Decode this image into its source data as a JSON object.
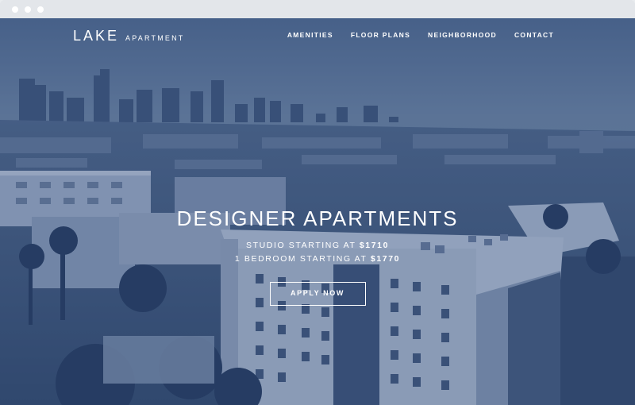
{
  "brand": {
    "name": "LAKE",
    "suffix": "APARTMENT"
  },
  "nav": {
    "items": [
      {
        "label": "AMENITIES"
      },
      {
        "label": "FLOOR PLANS"
      },
      {
        "label": "NEIGHBORHOOD"
      },
      {
        "label": "CONTACT"
      }
    ]
  },
  "hero": {
    "headline": "DESIGNER APARTMENTS",
    "studio_text": "STUDIO STARTING AT",
    "studio_price": "$1710",
    "bedroom_text": "1 BEDROOM STARTING AT",
    "bedroom_price": "$1770",
    "cta_label": "APPLY NOW"
  },
  "colors": {
    "overlay": "#33507e",
    "sky": "#5f7596",
    "text": "#ffffff"
  }
}
